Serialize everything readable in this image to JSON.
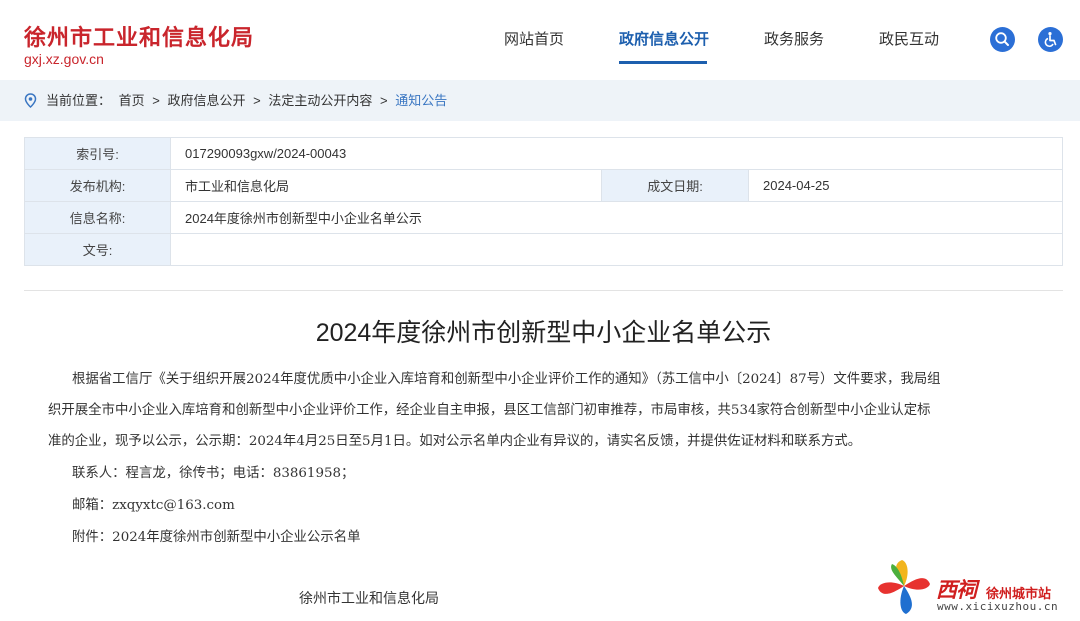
{
  "header": {
    "site_title": "徐州市工业和信息化局",
    "site_domain": "gxj.xz.gov.cn",
    "nav": [
      {
        "label": "网站首页",
        "active": false
      },
      {
        "label": "政府信息公开",
        "active": true
      },
      {
        "label": "政务服务",
        "active": false
      },
      {
        "label": "政民互动",
        "active": false
      }
    ],
    "search_icon": "search-icon",
    "accessibility_icon": "wheelchair-icon"
  },
  "breadcrumb": {
    "prefix": "当前位置：",
    "items": [
      "首页",
      "政府信息公开",
      "法定主动公开内容",
      "通知公告"
    ],
    "separator": ">"
  },
  "info": {
    "index_label": "索引号:",
    "index_value": "017290093gxw/2024-00043",
    "publisher_label": "发布机构:",
    "publisher_value": "市工业和信息化局",
    "date_label": "成文日期:",
    "date_value": "2024-04-25",
    "name_label": "信息名称:",
    "name_value": "2024年度徐州市创新型中小企业名单公示",
    "docno_label": "文号:",
    "docno_value": ""
  },
  "article": {
    "title": "2024年度徐州市创新型中小企业名单公示",
    "lines": [
      "根据省工信厅《关于组织开展2024年度优质中小企业入库培育和创新型中小企业评价工作的通知》（苏工信中小〔2024〕87号）文件要求，我局组",
      "织开展全市中小企业入库培育和创新型中小企业评价工作，经企业自主申报，县区工信部门初审推荐，市局审核，共534家符合创新型中小企业认定标",
      "准的企业，现予以公示，公示期：2024年4月25日至5月1日。如对公示名单内企业有异议的，请实名反馈，并提供佐证材料和联系方式。",
      "联系人：程言龙，徐传书；电话：83861958；",
      "邮箱：zxqyxtc@163.com",
      "附件：2024年度徐州市创新型中小企业公示名单"
    ],
    "signature": "徐州市工业和信息化局"
  },
  "watermark": {
    "brand": "西祠",
    "city": "徐州城市站",
    "url": "www.xicixuzhou.cn"
  },
  "colors": {
    "brand_red": "#c9252c",
    "nav_active": "#1d5fae",
    "icon_blue": "#2b6fd6",
    "breadcrumb_bg": "#eef3f8",
    "label_bg": "#e9f1fa"
  }
}
